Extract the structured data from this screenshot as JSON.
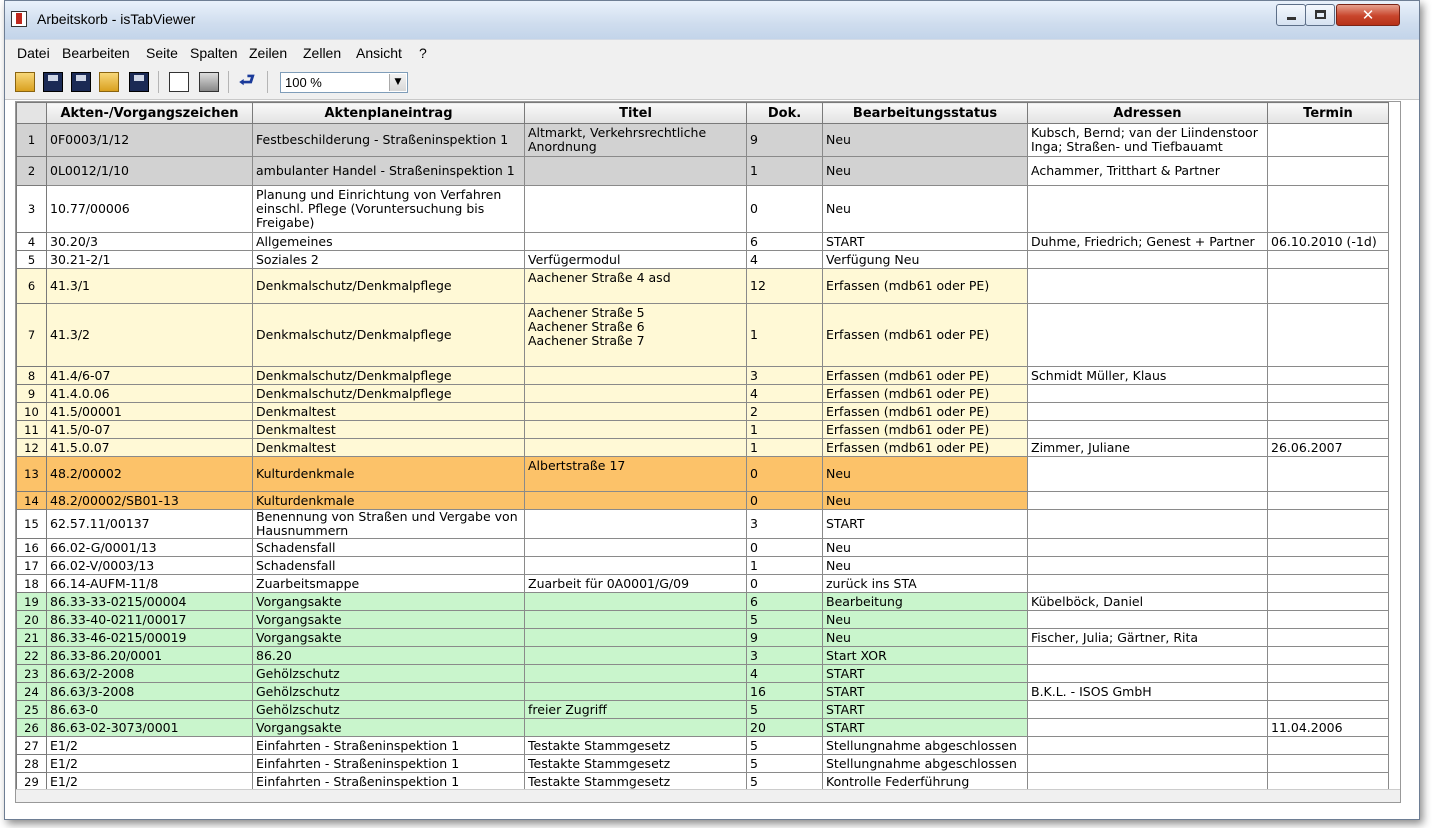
{
  "window": {
    "title": "Arbeitskorb - isTabViewer",
    "close_symbol": "✕",
    "min_label": "",
    "max_label": ""
  },
  "menu": [
    "Datei",
    "Bearbeiten",
    "Seite",
    "Spalten",
    "Zeilen",
    "Zellen",
    "Ansicht",
    "?"
  ],
  "toolbar": {
    "zoom_value": "100 %",
    "zoom_arrow": "▼",
    "wrap_icon": "⮐"
  },
  "columns": [
    "Akten-/Vorgangszeichen",
    "Aktenplaneintrag",
    "Titel",
    "Dok.",
    "Bearbeitungsstatus",
    "Adressen",
    "Termin"
  ],
  "rows": [
    {
      "n": "1",
      "color": "grey",
      "az": "0F0003/1/12",
      "ape": "Festbeschilderung - Straßeninspektion 1",
      "titel": "Altmarkt, Verkehrsrechtliche Anordnung",
      "dok": "9",
      "status": "Neu",
      "adr": "Kubsch, Bernd; van der Liindenstoor Inga; Straßen- und Tiefbauamt",
      "termin": ""
    },
    {
      "n": "2",
      "color": "grey",
      "az": "0L0012/1/10",
      "ape": "ambulanter Handel - Straßeninspektion 1",
      "titel": "",
      "dok": "1",
      "status": "Neu",
      "adr": "Achammer, Tritthart & Partner",
      "termin": ""
    },
    {
      "n": "3",
      "color": "white",
      "az": "10.77/00006",
      "ape": "Planung und Einrichtung von Verfahren einschl. Pflege (Voruntersuchung bis Freigabe)",
      "titel": "",
      "dok": "0",
      "status": "Neu",
      "adr": "",
      "termin": ""
    },
    {
      "n": "4",
      "color": "white",
      "az": "30.20/3",
      "ape": "Allgemeines",
      "titel": "",
      "dok": "6",
      "status": "START",
      "adr": "Duhme, Friedrich; Genest + Partner",
      "termin": "06.10.2010 (-1d)"
    },
    {
      "n": "5",
      "color": "white",
      "az": "30.21-2/1",
      "ape": "Soziales 2",
      "titel": "Verfügermodul",
      "dok": "4",
      "status": "Verfügung Neu",
      "adr": "",
      "termin": ""
    },
    {
      "n": "6",
      "color": "yellow",
      "az": "41.3/1",
      "ape": "Denkmalschutz/Denkmalpflege",
      "titel": "Aachener Straße 4 asd",
      "dok": "12",
      "status": "Erfassen (mdb61 oder PE)",
      "adr": "",
      "termin": ""
    },
    {
      "n": "7",
      "color": "yellow",
      "az": "41.3/2",
      "ape": "Denkmalschutz/Denkmalpflege",
      "titel": "Aachener Straße 5\nAachener Straße 6\nAachener Straße 7",
      "dok": "1",
      "status": "Erfassen (mdb61 oder PE)",
      "adr": "",
      "termin": ""
    },
    {
      "n": "8",
      "color": "yellow",
      "az": "41.4/6-07",
      "ape": "Denkmalschutz/Denkmalpflege",
      "titel": "",
      "dok": "3",
      "status": "Erfassen (mdb61 oder PE)",
      "adr": "Schmidt Müller, Klaus",
      "termin": ""
    },
    {
      "n": "9",
      "color": "yellow",
      "az": "41.4.0.06",
      "ape": "Denkmalschutz/Denkmalpflege",
      "titel": "",
      "dok": "4",
      "status": "Erfassen (mdb61 oder PE)",
      "adr": "",
      "termin": ""
    },
    {
      "n": "10",
      "color": "yellow",
      "az": "41.5/00001",
      "ape": "Denkmaltest",
      "titel": "",
      "dok": "2",
      "status": "Erfassen (mdb61 oder PE)",
      "adr": "",
      "termin": ""
    },
    {
      "n": "11",
      "color": "yellow",
      "az": "41.5/0-07",
      "ape": "Denkmaltest",
      "titel": "",
      "dok": "1",
      "status": "Erfassen (mdb61 oder PE)",
      "adr": "",
      "termin": ""
    },
    {
      "n": "12",
      "color": "yellow",
      "az": "41.5.0.07",
      "ape": "Denkmaltest",
      "titel": "",
      "dok": "1",
      "status": "Erfassen (mdb61 oder PE)",
      "adr": "Zimmer, Juliane",
      "termin": "26.06.2007"
    },
    {
      "n": "13",
      "color": "orange",
      "az": "48.2/00002",
      "ape": "Kulturdenkmale",
      "titel": "Albertstraße 17",
      "dok": "0",
      "status": "Neu",
      "adr": "",
      "termin": ""
    },
    {
      "n": "14",
      "color": "orange",
      "az": "48.2/00002/SB01-13",
      "ape": "Kulturdenkmale",
      "titel": "",
      "dok": "0",
      "status": "Neu",
      "adr": "",
      "termin": ""
    },
    {
      "n": "15",
      "color": "white",
      "az": "62.57.11/00137",
      "ape": "Benennung von Straßen und Vergabe von Hausnummern",
      "titel": "",
      "dok": "3",
      "status": "START",
      "adr": "",
      "termin": ""
    },
    {
      "n": "16",
      "color": "white",
      "az": "66.02-G/0001/13",
      "ape": "Schadensfall",
      "titel": "",
      "dok": "0",
      "status": "Neu",
      "adr": "",
      "termin": ""
    },
    {
      "n": "17",
      "color": "white",
      "az": "66.02-V/0003/13",
      "ape": "Schadensfall",
      "titel": "",
      "dok": "1",
      "status": "Neu",
      "adr": "",
      "termin": ""
    },
    {
      "n": "18",
      "color": "white",
      "az": "66.14-AUFM-11/8",
      "ape": "Zuarbeitsmappe",
      "titel": "Zuarbeit für 0A0001/G/09",
      "dok": "0",
      "status": "zurück ins STA",
      "adr": "",
      "termin": ""
    },
    {
      "n": "19",
      "color": "green",
      "az": "86.33-33-0215/00004",
      "ape": "Vorgangsakte",
      "titel": "",
      "dok": "6",
      "status": "Bearbeitung",
      "adr": "Kübelböck, Daniel",
      "termin": ""
    },
    {
      "n": "20",
      "color": "green",
      "az": "86.33-40-0211/00017",
      "ape": "Vorgangsakte",
      "titel": "",
      "dok": "5",
      "status": "Neu",
      "adr": "",
      "termin": ""
    },
    {
      "n": "21",
      "color": "green",
      "az": "86.33-46-0215/00019",
      "ape": "Vorgangsakte",
      "titel": "",
      "dok": "9",
      "status": "Neu",
      "adr": "Fischer, Julia; Gärtner, Rita",
      "termin": ""
    },
    {
      "n": "22",
      "color": "green",
      "az": "86.33-86.20/0001",
      "ape": "86.20",
      "titel": "",
      "dok": "3",
      "status": "Start XOR",
      "adr": "",
      "termin": ""
    },
    {
      "n": "23",
      "color": "green",
      "az": "86.63/2-2008",
      "ape": "Gehölzschutz",
      "titel": "",
      "dok": "4",
      "status": "START",
      "adr": "",
      "termin": ""
    },
    {
      "n": "24",
      "color": "green",
      "az": "86.63/3-2008",
      "ape": "Gehölzschutz",
      "titel": "",
      "dok": "16",
      "status": "START",
      "adr": "B.K.L. - ISOS GmbH",
      "termin": ""
    },
    {
      "n": "25",
      "color": "green",
      "az": "86.63-0",
      "ape": "Gehölzschutz",
      "titel": "freier Zugriff",
      "dok": "5",
      "status": "START",
      "adr": "",
      "termin": ""
    },
    {
      "n": "26",
      "color": "green",
      "az": "86.63-02-3073/0001",
      "ape": "Vorgangsakte",
      "titel": "",
      "dok": "20",
      "status": "START",
      "adr": "",
      "termin": "11.04.2006"
    },
    {
      "n": "27",
      "color": "white",
      "az": "E1/2",
      "ape": "Einfahrten - Straßeninspektion 1",
      "titel": "Testakte Stammgesetz",
      "dok": "5",
      "status": "Stellungnahme abgeschlossen",
      "adr": "",
      "termin": ""
    },
    {
      "n": "28",
      "color": "white",
      "az": "E1/2",
      "ape": "Einfahrten - Straßeninspektion 1",
      "titel": "Testakte Stammgesetz",
      "dok": "5",
      "status": "Stellungnahme abgeschlossen",
      "adr": "",
      "termin": ""
    },
    {
      "n": "29",
      "color": "white",
      "az": "E1/2",
      "ape": "Einfahrten - Straßeninspektion 1",
      "titel": "Testakte Stammgesetz",
      "dok": "5",
      "status": "Kontrolle Federführung",
      "adr": "",
      "termin": ""
    }
  ]
}
